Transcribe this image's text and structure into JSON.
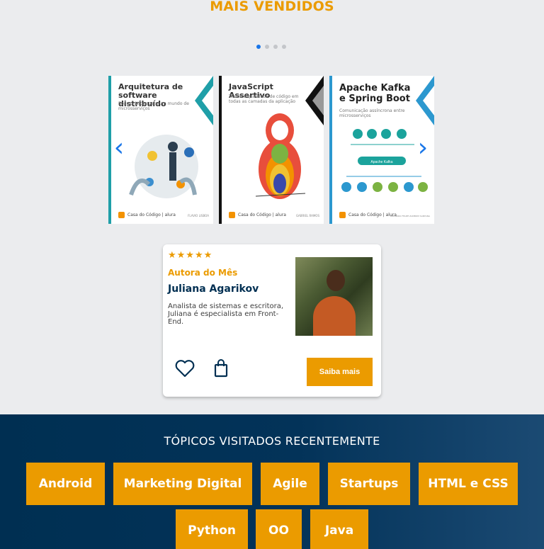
{
  "bestsellers": {
    "title": "MAIS VENDIDOS",
    "books": [
      {
        "title": "Arquitetura de software distribuído",
        "subtitle": "Boas práticas para um mundo de microsserviços",
        "author": "FLAVIO LISBOA",
        "publisher": "Casa do Código | alura"
      },
      {
        "title": "JavaScript Assertivo",
        "subtitle": "Testes e qualidade de código em todas as camadas da aplicação",
        "author": "GABRIEL RAMOS",
        "publisher": "Casa do Código | alura"
      },
      {
        "title": "Apache Kafka e Spring Boot",
        "subtitle": "Comunicação assíncrona entre microsserviços",
        "author": "EDUARDO FELIPE ZAMBOM SANTANA",
        "publisher": "Casa do Código | alura"
      }
    ],
    "kafka_label": "Apache Kafka",
    "prev_arrow": "‹",
    "next_arrow": "›"
  },
  "author_card": {
    "stars": "★★★★★",
    "label": "Autora do Mês",
    "name": "Juliana Agarikov",
    "bio": "Analista de sistemas e escritora, Juliana é especialista em Front-End.",
    "button": "Saiba mais"
  },
  "topics": {
    "title": "TÓPICOS VISITADOS RECENTEMENTE",
    "tags": [
      "Android",
      "Marketing Digital",
      "Agile",
      "Startups",
      "HTML e CSS",
      "Python",
      "OO",
      "Java"
    ]
  },
  "colors": {
    "accent": "#eb9b00",
    "primary": "#002f52",
    "link": "#1875e8"
  }
}
